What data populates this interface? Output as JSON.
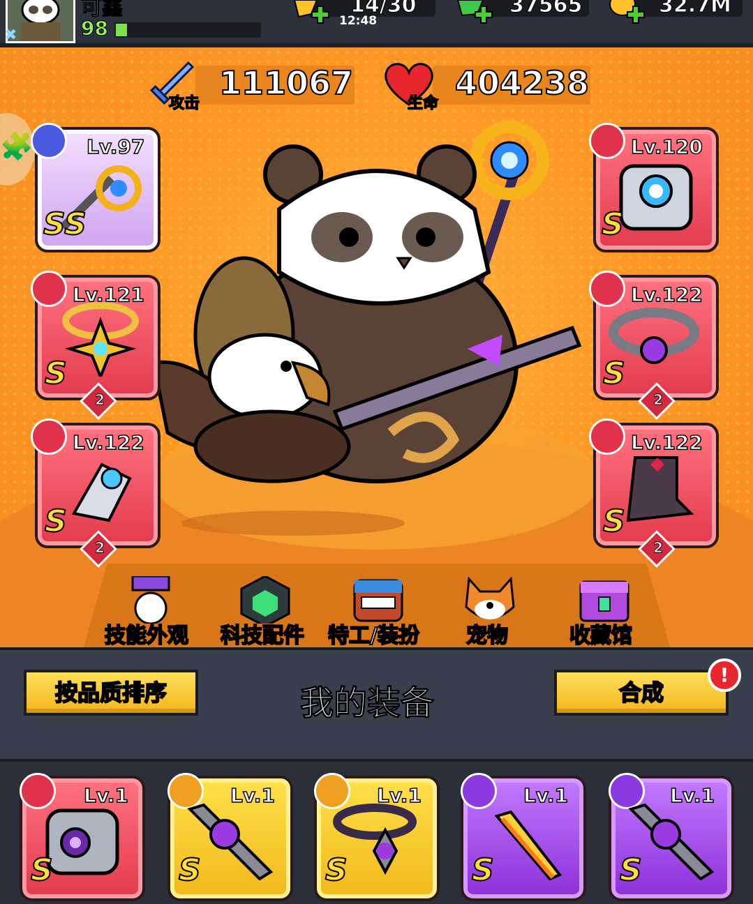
{
  "player": {
    "name": "可鑫",
    "level": "98"
  },
  "resources": [
    {
      "name": "energy",
      "value": "14/30",
      "timer": "12:48"
    },
    {
      "name": "gems",
      "value": "37565"
    },
    {
      "name": "coins",
      "value": "32.7M"
    }
  ],
  "stats": {
    "attack": {
      "label": "攻击",
      "value": "111067"
    },
    "hp": {
      "label": "生命",
      "value": "404238"
    }
  },
  "equipped": {
    "weapon": {
      "level": "Lv.97",
      "grade": "SS",
      "color": "purple"
    },
    "armor": {
      "level": "Lv.120",
      "grade": "S",
      "color": "red"
    },
    "necklace": {
      "level": "Lv.121",
      "grade": "S",
      "stars": "2",
      "color": "red"
    },
    "belt": {
      "level": "Lv.122",
      "grade": "S",
      "stars": "2",
      "color": "red"
    },
    "gloves": {
      "level": "Lv.122",
      "grade": "S",
      "stars": "2",
      "color": "red"
    },
    "boots": {
      "level": "Lv.122",
      "grade": "S",
      "stars": "2",
      "color": "red"
    }
  },
  "menu": [
    {
      "label": "技能外观",
      "icon": "soccer-hat-icon"
    },
    {
      "label": "科技配件",
      "icon": "hexagon-chip-icon"
    },
    {
      "label": "特工/装扮",
      "icon": "agent-head-icon"
    },
    {
      "label": "宠物",
      "icon": "shiba-icon"
    },
    {
      "label": "收藏馆",
      "icon": "treasure-chest-icon"
    }
  ],
  "panel": {
    "sort_label": "按品质排序",
    "title": "我的装备",
    "merge_label": "合成",
    "merge_alert": "!"
  },
  "inventory": [
    {
      "level": "Lv.1",
      "grade": "S",
      "color": "red",
      "type": "armor"
    },
    {
      "level": "Lv.1",
      "grade": "S",
      "color": "yellow",
      "type": "weapon"
    },
    {
      "level": "Lv.1",
      "grade": "S",
      "color": "yellow",
      "type": "necklace"
    },
    {
      "level": "Lv.1",
      "grade": "S",
      "color": "violet",
      "type": "weapon"
    },
    {
      "level": "Lv.1",
      "grade": "S",
      "color": "violet",
      "type": "weapon"
    }
  ]
}
